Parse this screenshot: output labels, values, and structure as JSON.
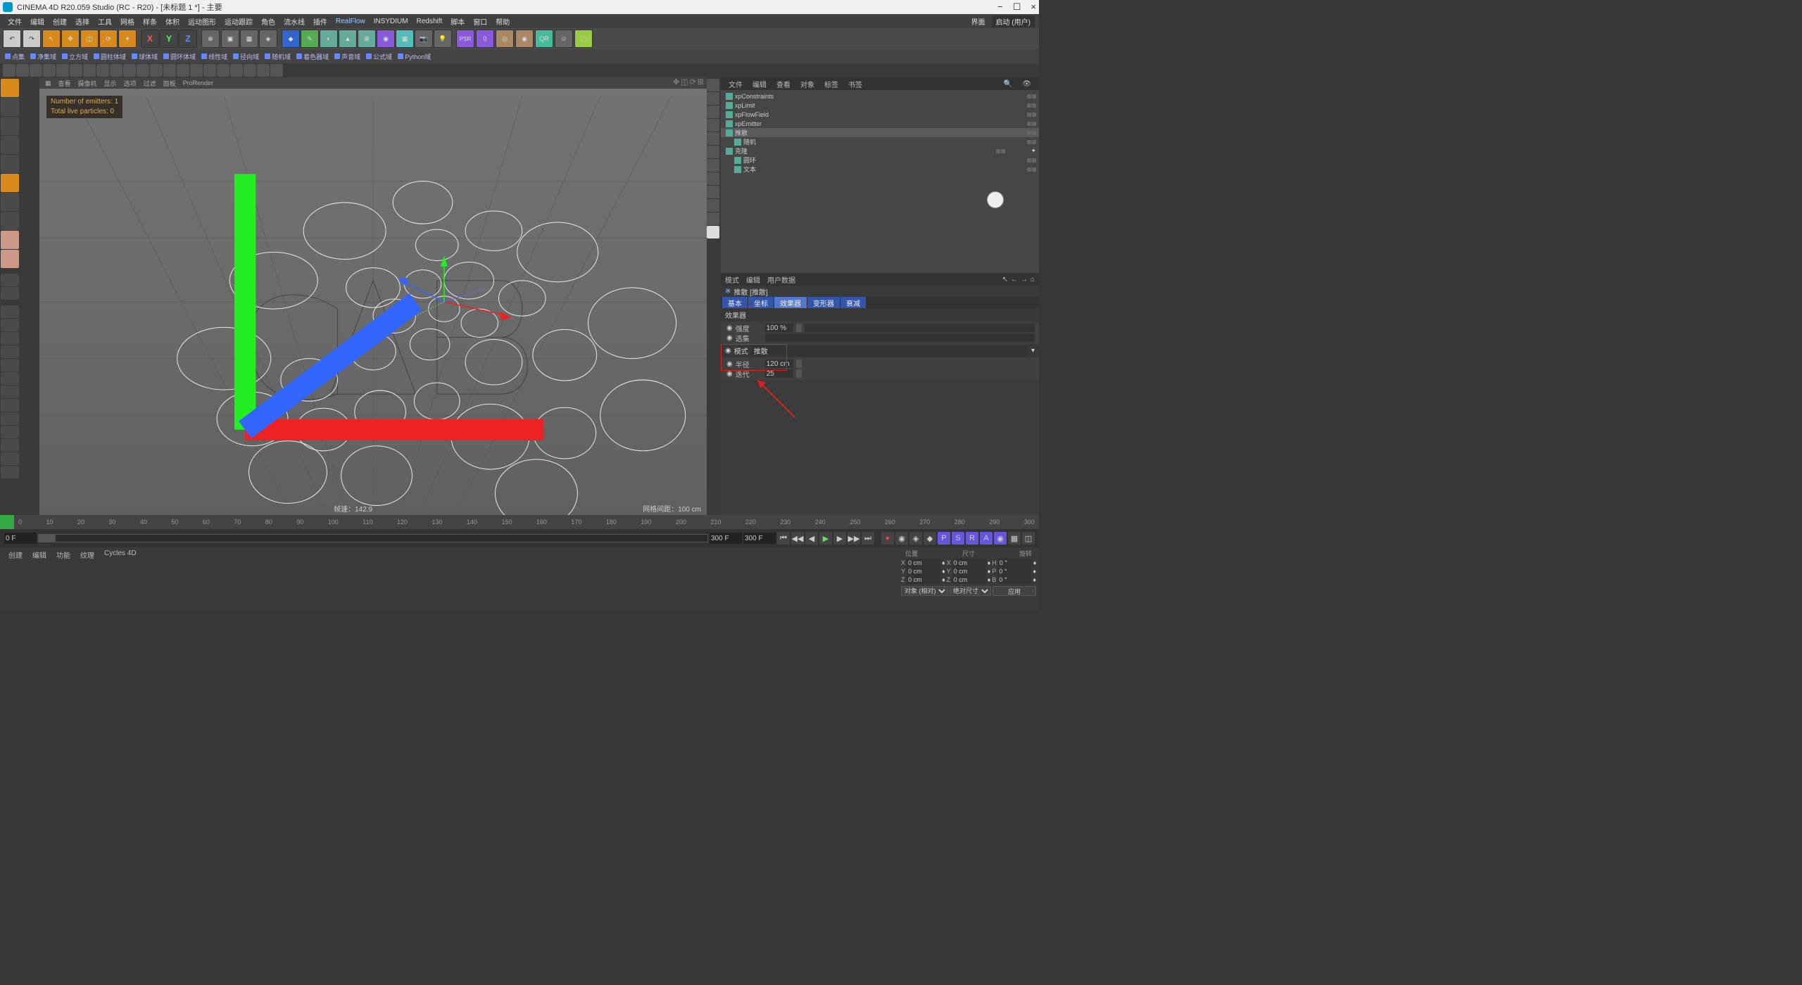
{
  "titlebar": {
    "app": "CINEMA 4D R20.059 Studio (RC - R20) - [未标题 1 *] - 主要",
    "min": "−",
    "max": "☐",
    "close": "×"
  },
  "layout": {
    "label": "界面",
    "value": "启动 (用户)"
  },
  "menu": [
    "文件",
    "编辑",
    "创建",
    "选择",
    "工具",
    "网格",
    "样条",
    "体积",
    "运动图形",
    "运动跟踪",
    "角色",
    "流水线",
    "插件",
    "RealFlow",
    "INSYDIUM",
    "Redshift",
    "脚本",
    "窗口",
    "帮助"
  ],
  "toolbar2": [
    "点集",
    "净集域",
    "立方域",
    "圆柱体域",
    "球体域",
    "圆环体域",
    "线性域",
    "径向域",
    "随机域",
    "着色器域",
    "声音域",
    "公式域",
    "Python域"
  ],
  "viewheader": [
    "查看",
    "摄像机",
    "显示",
    "选项",
    "过滤",
    "面板",
    "ProRender"
  ],
  "overlay": {
    "line1": "Number of emitters: 1",
    "line2": "Total live particles: 0"
  },
  "vp_footer": {
    "left": "帧速：142.9",
    "right": "网格间距：100 cm"
  },
  "objects": {
    "tabs": [
      "文件",
      "编辑",
      "查看",
      "对象",
      "标签",
      "书签"
    ],
    "items": [
      {
        "name": "xpConstraints",
        "cls": "a"
      },
      {
        "name": "xpLimit",
        "cls": "a"
      },
      {
        "name": "xpFlowField",
        "cls": "a"
      },
      {
        "name": "xpEmitter",
        "cls": "a"
      },
      {
        "name": "推散",
        "cls": "b",
        "sel": true
      },
      {
        "name": "随机",
        "cls": "b",
        "indent": 12
      },
      {
        "name": "克隆",
        "cls": "c",
        "indent": 0,
        "extra": true
      },
      {
        "name": "圆环",
        "cls": "d",
        "indent": 12
      },
      {
        "name": "文本",
        "cls": "d",
        "indent": 12
      }
    ]
  },
  "attr": {
    "tabs": [
      "模式",
      "编辑",
      "用户数据"
    ],
    "title_icon": "※",
    "title": "推散 [推散]",
    "sub_tabs": [
      "基本",
      "坐标",
      "效果器",
      "变形器",
      "衰减"
    ],
    "section1": "效果器",
    "strength_label": "强度",
    "strength_val": "100 %",
    "sel_label": "选集",
    "mode_label": "模式",
    "mode_val": "推散",
    "section2_rows": [
      {
        "label": "半径",
        "val": "120 cm"
      },
      {
        "label": "迭代",
        "val": "25"
      }
    ]
  },
  "timeline": {
    "ticks": [
      "0",
      "10",
      "20",
      "30",
      "40",
      "50",
      "60",
      "70",
      "80",
      "90",
      "100",
      "110",
      "120",
      "130",
      "140",
      "150",
      "160",
      "170",
      "180",
      "190",
      "200",
      "210",
      "220",
      "230",
      "240",
      "250",
      "260",
      "270",
      "280",
      "290",
      "300"
    ]
  },
  "transport": {
    "start": "0 F",
    "cur": "0 F",
    "end": "300 F",
    "end2": "300 F"
  },
  "bottom_tabs": [
    "创建",
    "编辑",
    "功能",
    "纹理",
    "Cycles 4D"
  ],
  "coords": {
    "hdr": [
      "位置",
      "尺寸",
      "旋转"
    ],
    "rows": [
      {
        "axis": "X",
        "p": "0 cm",
        "s": "0 cm",
        "r": "0 °",
        "pre": "X",
        "pre2": "H"
      },
      {
        "axis": "Y",
        "p": "0 cm",
        "s": "0 cm",
        "r": "0 °",
        "pre": "Y",
        "pre2": "P"
      },
      {
        "axis": "Z",
        "p": "0 cm",
        "s": "0 cm",
        "r": "0 °",
        "pre": "Z",
        "pre2": "B"
      }
    ],
    "drop1": "对象 (相对)",
    "drop2": "绝对尺寸",
    "apply": "应用"
  }
}
